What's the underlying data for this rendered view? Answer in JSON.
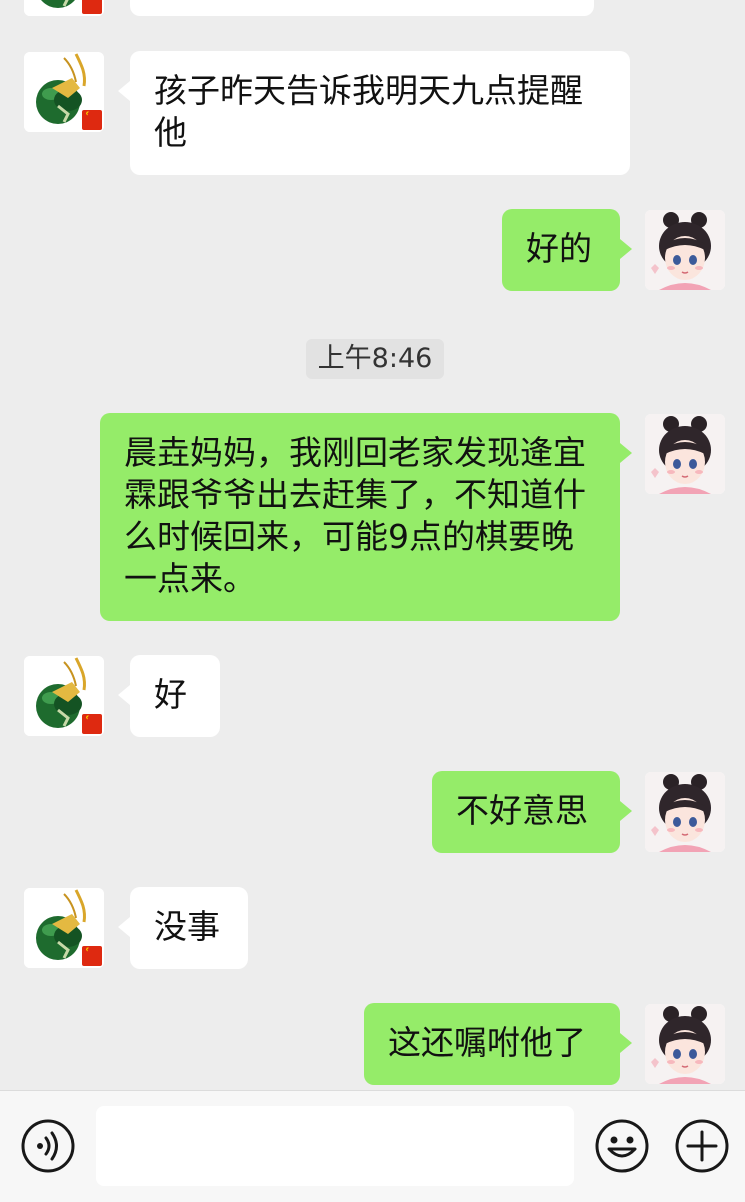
{
  "conversation": {
    "timestamp": "上午8:46",
    "messages": [
      {
        "sender": "contact",
        "text": "孩子昨天告诉我明天九点提醒他"
      },
      {
        "sender": "me",
        "text": "好的"
      },
      {
        "sender": "me",
        "text": "晨垚妈妈，我刚回老家发现逄宜霖跟爷爷出去赶集了，不知道什么时候回来，可能9点的棋要晚一点来。"
      },
      {
        "sender": "contact",
        "text": "好"
      },
      {
        "sender": "me",
        "text": "不好意思"
      },
      {
        "sender": "contact",
        "text": "没事"
      },
      {
        "sender": "me",
        "text": "这还嘱咐他了"
      }
    ]
  },
  "input_bar": {
    "message_value": "",
    "left_icon": "voice-icon",
    "right_icons": [
      "emoji-icon",
      "plus-icon"
    ]
  },
  "colors": {
    "chat_background": "#ededed",
    "outgoing_bubble": "#95ec69",
    "incoming_bubble": "#ffffff",
    "timestamp_pill": "#e2e2e2",
    "input_bar": "#f7f7f7"
  }
}
